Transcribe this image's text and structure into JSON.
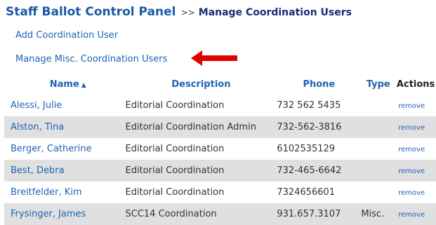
{
  "header": {
    "title": "Staff Ballot Control Panel",
    "separator": ">>",
    "current_page": "Manage Coordination Users"
  },
  "actions": {
    "add_user": "Add Coordination User",
    "manage_misc": "Manage Misc. Coordination Users"
  },
  "annotation": {
    "arrow_color": "#e00000"
  },
  "table": {
    "columns": {
      "name": "Name",
      "name_sort_indicator": "▲",
      "description": "Description",
      "phone": "Phone",
      "type": "Type",
      "actions": "Actions"
    },
    "rows": [
      {
        "name": "Alessi, Julie",
        "description": "Editorial Coordination",
        "phone": "732 562 5435",
        "type": "",
        "action": "remove"
      },
      {
        "name": "Alston, Tina",
        "description": "Editorial Coordination Admin",
        "phone": "732-562-3816",
        "type": "",
        "action": "remove"
      },
      {
        "name": "Berger, Catherine",
        "description": "Editorial Coordination",
        "phone": "6102535129",
        "type": "",
        "action": "remove"
      },
      {
        "name": "Best, Debra",
        "description": "Editorial Coordination",
        "phone": "732-465-6642",
        "type": "",
        "action": "remove"
      },
      {
        "name": "Breitfelder, Kim",
        "description": "Editorial Coordination",
        "phone": "7324656601",
        "type": "",
        "action": "remove"
      },
      {
        "name": "Frysinger, James",
        "description": "SCC14 Coordination",
        "phone": "931.657.3107",
        "type": "Misc.",
        "action": "remove"
      }
    ]
  },
  "colors": {
    "link": "#1f63b5",
    "title": "#1a5aa6",
    "breadcrumb_current": "#1c2a78",
    "alt_row_bg": "#e0e0e0"
  }
}
